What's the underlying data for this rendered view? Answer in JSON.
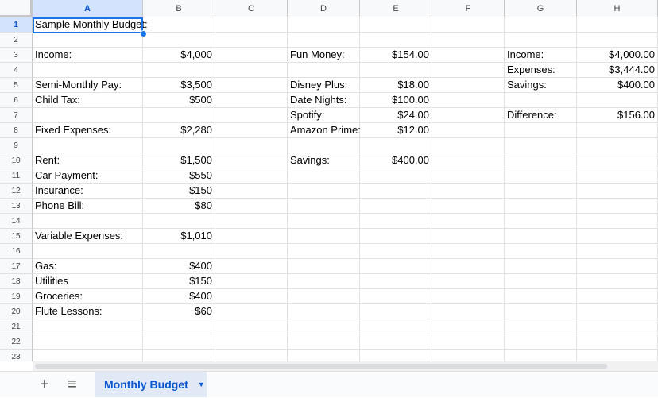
{
  "columns": [
    "A",
    "B",
    "C",
    "D",
    "E",
    "F",
    "G",
    "H"
  ],
  "selected_col": "A",
  "selected_row": 1,
  "rows": [
    1,
    2,
    3,
    4,
    5,
    6,
    7,
    8,
    9,
    10,
    11,
    12,
    13,
    14,
    15,
    16,
    17,
    18,
    19,
    20,
    21,
    22,
    23
  ],
  "cells": [
    {
      "ref": "A1",
      "value": "Sample Monthly Budget:"
    },
    {
      "ref": "A3",
      "value": "Income:"
    },
    {
      "ref": "B3",
      "value": "$4,000"
    },
    {
      "ref": "D3",
      "value": "Fun Money:"
    },
    {
      "ref": "E3",
      "value": "$154.00"
    },
    {
      "ref": "G3",
      "value": "Income:"
    },
    {
      "ref": "H3",
      "value": "$4,000.00"
    },
    {
      "ref": "G4",
      "value": "Expenses:"
    },
    {
      "ref": "H4",
      "value": "$3,444.00"
    },
    {
      "ref": "A5",
      "value": "Semi-Monthly Pay:"
    },
    {
      "ref": "B5",
      "value": "$3,500"
    },
    {
      "ref": "D5",
      "value": "Disney Plus:"
    },
    {
      "ref": "E5",
      "value": "$18.00"
    },
    {
      "ref": "G5",
      "value": "Savings:"
    },
    {
      "ref": "H5",
      "value": "$400.00"
    },
    {
      "ref": "A6",
      "value": "Child Tax:"
    },
    {
      "ref": "B6",
      "value": "$500"
    },
    {
      "ref": "D6",
      "value": "Date Nights:"
    },
    {
      "ref": "E6",
      "value": "$100.00"
    },
    {
      "ref": "D7",
      "value": "Spotify:"
    },
    {
      "ref": "E7",
      "value": "$24.00"
    },
    {
      "ref": "G7",
      "value": "Difference:"
    },
    {
      "ref": "H7",
      "value": "$156.00"
    },
    {
      "ref": "A8",
      "value": "Fixed Expenses:"
    },
    {
      "ref": "B8",
      "value": "$2,280"
    },
    {
      "ref": "D8",
      "value": "Amazon Prime:"
    },
    {
      "ref": "E8",
      "value": "$12.00"
    },
    {
      "ref": "A10",
      "value": "Rent:"
    },
    {
      "ref": "B10",
      "value": "$1,500"
    },
    {
      "ref": "D10",
      "value": "Savings:"
    },
    {
      "ref": "E10",
      "value": "$400.00"
    },
    {
      "ref": "A11",
      "value": "Car Payment:"
    },
    {
      "ref": "B11",
      "value": "$550"
    },
    {
      "ref": "A12",
      "value": "Insurance:"
    },
    {
      "ref": "B12",
      "value": "$150"
    },
    {
      "ref": "A13",
      "value": "Phone Bill:"
    },
    {
      "ref": "B13",
      "value": "$80"
    },
    {
      "ref": "A15",
      "value": "Variable Expenses:"
    },
    {
      "ref": "B15",
      "value": "$1,010"
    },
    {
      "ref": "A17",
      "value": "Gas:"
    },
    {
      "ref": "B17",
      "value": "$400"
    },
    {
      "ref": "A18",
      "value": "Utilities"
    },
    {
      "ref": "B18",
      "value": "$150"
    },
    {
      "ref": "A19",
      "value": "Groceries:"
    },
    {
      "ref": "B19",
      "value": "$400"
    },
    {
      "ref": "A20",
      "value": "Flute Lessons:"
    },
    {
      "ref": "B20",
      "value": "$60"
    }
  ],
  "tabbar": {
    "add_icon": "+",
    "menu_icon": "≡",
    "sheet_tab_label": "Monthly Budget",
    "sheet_tab_caret": "▼"
  }
}
